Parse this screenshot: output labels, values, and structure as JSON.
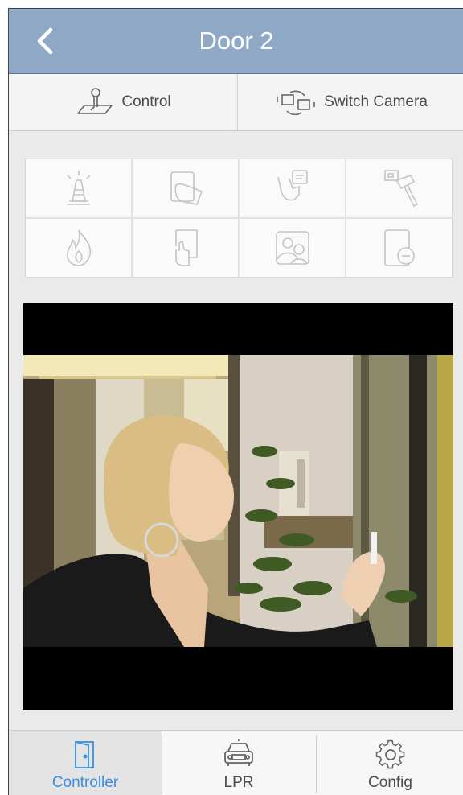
{
  "header": {
    "title": "Door 2",
    "back_icon": "chevron-left-icon"
  },
  "toolbar": {
    "control_label": "Control",
    "control_icon": "hand-tap-icon",
    "switch_camera_label": "Switch Camera",
    "switch_camera_icon": "switch-camera-icon"
  },
  "actions": [
    {
      "icon": "alarm-beacon-icon"
    },
    {
      "icon": "card-swipe-icon"
    },
    {
      "icon": "hand-card-icon"
    },
    {
      "icon": "hammer-tamper-icon"
    },
    {
      "icon": "fire-icon"
    },
    {
      "icon": "door-push-icon"
    },
    {
      "icon": "persons-icon"
    },
    {
      "icon": "card-remove-icon"
    }
  ],
  "video": {
    "description_icon": "camera-feed"
  },
  "tabs": [
    {
      "label": "Controller",
      "icon": "door-icon",
      "active": true
    },
    {
      "label": "LPR",
      "icon": "car-icon",
      "active": false
    },
    {
      "label": "Config",
      "icon": "gear-icon",
      "active": false
    }
  ],
  "colors": {
    "header": "#8fa8c5",
    "accent": "#3a8fe0",
    "icon_gray": "#c8c8c8"
  }
}
